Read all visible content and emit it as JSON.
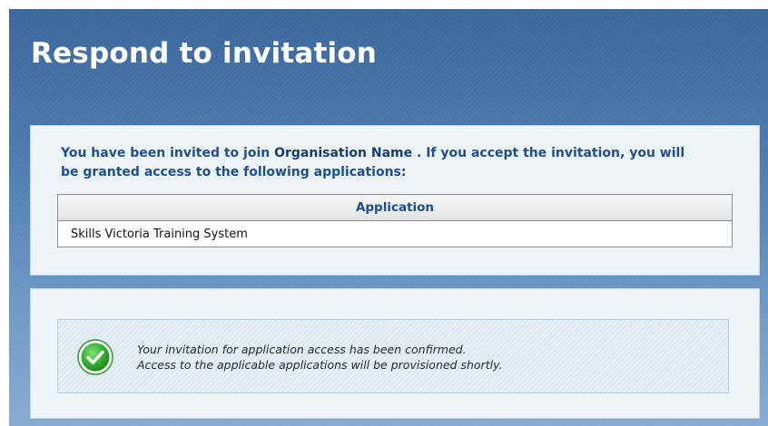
{
  "page": {
    "title": "Respond to invitation"
  },
  "invitation": {
    "text_before": "You have been invited to join ",
    "organisation": "Organisation Name",
    "text_after": "  . If you accept the invitation, you will be granted access to the following applications:"
  },
  "applications_table": {
    "headers": [
      "Application"
    ],
    "rows": [
      [
        "Skills Victoria Training System"
      ]
    ]
  },
  "status": {
    "icon": "check-circle-icon",
    "line1": "Your invitation for application access has been confirmed.",
    "line2": "Access to the applicable applications will be provisioned shortly.",
    "icon_color": "#3cb83a"
  }
}
